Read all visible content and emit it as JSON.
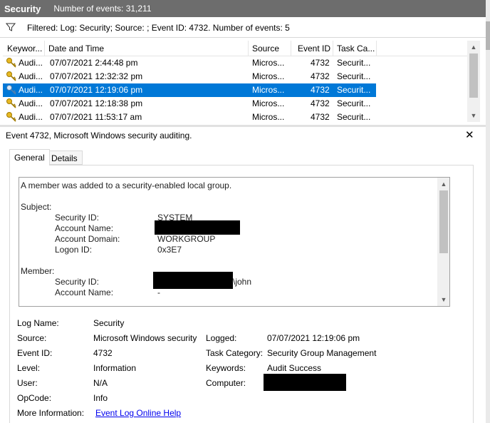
{
  "title": {
    "log_name": "Security",
    "event_count": "Number of events: 31,211"
  },
  "filter": {
    "icon": "filter-icon",
    "text": "Filtered: Log: Security; Source: ; Event ID: 4732. Number of events: 5"
  },
  "grid": {
    "columns": [
      "Keywor...",
      "Date and Time",
      "Source",
      "Event ID",
      "Task Ca..."
    ],
    "rows": [
      {
        "keyword": "Audi...",
        "datetime": "07/07/2021 2:44:48 pm",
        "source": "Micros...",
        "event_id": "4732",
        "task": "Securit..."
      },
      {
        "keyword": "Audi...",
        "datetime": "07/07/2021 12:32:32 pm",
        "source": "Micros...",
        "event_id": "4732",
        "task": "Securit..."
      },
      {
        "keyword": "Audi...",
        "datetime": "07/07/2021 12:19:06 pm",
        "source": "Micros...",
        "event_id": "4732",
        "task": "Securit..."
      },
      {
        "keyword": "Audi...",
        "datetime": "07/07/2021 12:18:38 pm",
        "source": "Micros...",
        "event_id": "4732",
        "task": "Securit..."
      },
      {
        "keyword": "Audi...",
        "datetime": "07/07/2021 11:53:17 am",
        "source": "Micros...",
        "event_id": "4732",
        "task": "Securit..."
      }
    ],
    "selected_row": 2
  },
  "detail": {
    "title": "Event 4732, Microsoft Windows security auditing.",
    "close": "✕",
    "tabs": [
      "General",
      "Details"
    ],
    "message": {
      "intro": "A member was added to a security-enabled local group.",
      "subject_label": "Subject:",
      "subject": [
        {
          "key": "Security ID:",
          "value": "SYSTEM"
        },
        {
          "key": "Account Name:",
          "value": ""
        },
        {
          "key": "Account Domain:",
          "value": "WORKGROUP"
        },
        {
          "key": "Logon ID:",
          "value": "0x3E7"
        }
      ],
      "member_label": "Member:",
      "member": [
        {
          "key": "Security ID:",
          "value": "\\john"
        },
        {
          "key": "Account Name:",
          "value": "-"
        }
      ]
    },
    "fields": {
      "log_name_label": "Log Name:",
      "log_name": "Security",
      "source_label": "Source:",
      "source": "Microsoft Windows security",
      "logged_label": "Logged:",
      "logged": "07/07/2021 12:19:06 pm",
      "event_id_label": "Event ID:",
      "event_id": "4732",
      "task_category_label": "Task Category:",
      "task_category": "Security Group Management",
      "level_label": "Level:",
      "level": "Information",
      "keywords_label": "Keywords:",
      "keywords": "Audit Success",
      "user_label": "User:",
      "user": "N/A",
      "computer_label": "Computer:",
      "computer": "",
      "opcode_label": "OpCode:",
      "opcode": "Info",
      "more_info_label": "More Information:",
      "more_info_link": "Event Log Online Help"
    }
  }
}
